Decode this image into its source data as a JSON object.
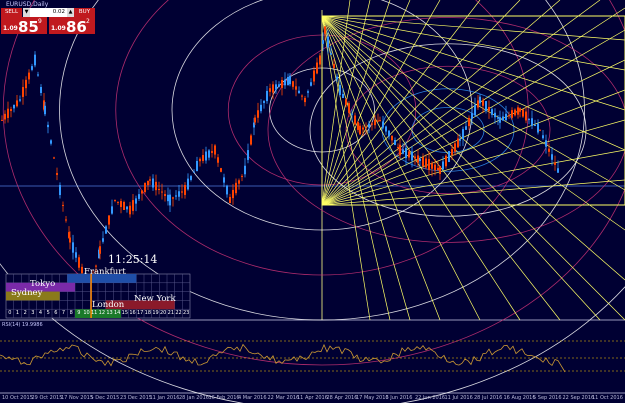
{
  "chart": {
    "title": "EURUSD,Daily",
    "rsi_label": "RSI(14) 19.9986",
    "clock": "11:25:14",
    "date_labels": [
      "10 Oct 2015",
      "29 Oct 2015",
      "17 Nov 2015",
      "5 Dec 2015",
      "23 Dec 2015",
      "11 Jan 2016",
      "28 Jan 2016",
      "16 Feb 2016",
      "4 Mar 2016",
      "22 Mar 2016",
      "11 Apr 2016",
      "28 Apr 2016",
      "17 May 2016",
      "3 Jun 2016",
      "22 Jun 2016",
      "11 Jul 2016",
      "28 Jul 2016",
      "16 Aug 2016",
      "5 Sep 2016",
      "22 Sep 2016",
      "11 Oct 2016"
    ],
    "colors": {
      "background": "#000033",
      "bull": "#3399ff",
      "bear": "#ff4400",
      "gann": "#ffff66",
      "circle_pink": "#cc3377",
      "circle_white": "#ffffff",
      "rsi": "#cc9933",
      "rsi_level": "#ffcc00"
    }
  },
  "trade_panel": {
    "sell_label": "SELL",
    "buy_label": "BUY",
    "lot_value": "0.02",
    "lot_down": "▼",
    "lot_up": "▲",
    "sell_prefix": "1.09",
    "sell_big": "85",
    "sell_sup": "9",
    "buy_prefix": "1.09",
    "buy_big": "86",
    "buy_sup": "2"
  },
  "sessions": {
    "frankfurt": "Frankfurt",
    "tokyo": "Tokyo",
    "sydney": "Sydney",
    "new_york": "New York",
    "london": "London",
    "hours": [
      "0",
      "1",
      "2",
      "3",
      "4",
      "5",
      "6",
      "7",
      "8",
      "9",
      "10",
      "11",
      "12",
      "13",
      "14",
      "15",
      "16",
      "17",
      "18",
      "19",
      "20",
      "21",
      "22",
      "23"
    ]
  }
}
